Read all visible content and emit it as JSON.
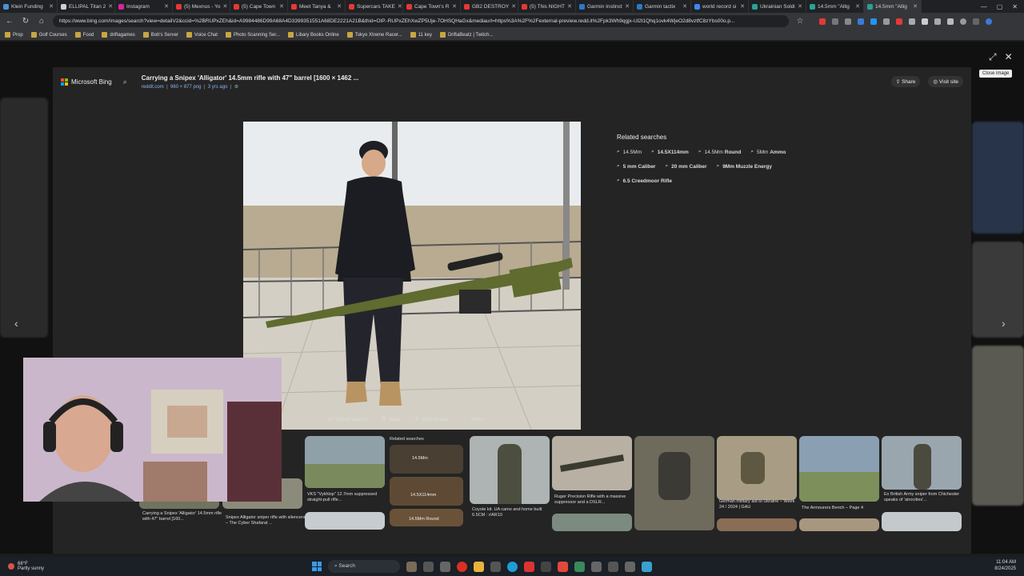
{
  "tabs": [
    {
      "label": "Klein Funding",
      "color": "#4a90d9"
    },
    {
      "label": "ELLIPAL Titan 2",
      "color": "#cfcfcf"
    },
    {
      "label": "Instagram",
      "color": "#d6249f"
    },
    {
      "label": "(5) Mexnus - Yo",
      "color": "#e53935"
    },
    {
      "label": "(5) Cape Town",
      "color": "#e53935"
    },
    {
      "label": "Meet Tanya &",
      "color": "#e53935"
    },
    {
      "label": "Supercars TAKE",
      "color": "#e53935"
    },
    {
      "label": "Cape Town's R",
      "color": "#e53935"
    },
    {
      "label": "GB2 DESTROY",
      "color": "#e53935"
    },
    {
      "label": "(5) This NIGHT",
      "color": "#e53935"
    },
    {
      "label": "Garmin Instinct",
      "color": "#2a7ac9"
    },
    {
      "label": "Garmin tactix",
      "color": "#2a7ac9"
    },
    {
      "label": "world record si",
      "color": "#4285f4"
    },
    {
      "label": "Ukrainian Soldi",
      "color": "#2aa198"
    },
    {
      "label": "14.5mm \"Allig",
      "color": "#2aa198"
    },
    {
      "label": "14.5mm \"Allig",
      "color": "#2aa198"
    }
  ],
  "address": {
    "url": "https://www.bing.com/images/search?view=detailV2&ccid=%2BRUPxZEh&id=A9984486D99A68A4D3399351551A68DE2221A21B&thid=OIP.-RUPxZEhXwZP5Uje-7OHSQHaGx&mediaurl=https%3A%2F%2Fexternal-preview.redd.it%2Fpk3Wh9qgjx-Ul2t1Qhq1ovk4WjeO2d8vztfC8zYbs00o.p..."
  },
  "bookmarks": [
    "Prop",
    "Golf Courses",
    "Food",
    "driftagames",
    "Bob's Server",
    "Voice Chat",
    "Photo Scanning Ser...",
    "Libary Books Online",
    "Tokyo Xtreme Racer...",
    "11 key",
    "DriftaBeatz | Twitch..."
  ],
  "modal": {
    "brand": "Microsoft Bing",
    "title": "Carrying a Snipex 'Alligator' 14.5mm rifle with 47\" barrel [1600 × 1462 ...",
    "source": "reddit.com",
    "size": "960 × 877 png",
    "age": "3 yrs ago",
    "share": "Share",
    "visit": "Visit site",
    "close_tip": "Close image"
  },
  "related": {
    "heading": "Related searches",
    "chips": [
      {
        "pre": "14.5Mm",
        "bold": ""
      },
      {
        "pre": "",
        "bold": "14.5X114mm"
      },
      {
        "pre": "14.5Mm ",
        "bold": "Round"
      },
      {
        "pre": "5Mm ",
        "bold": "Ammo"
      },
      {
        "pre": "",
        "bold": "5 mm Caliber"
      },
      {
        "pre": "",
        "bold": "20 mm Caliber"
      },
      {
        "pre": "",
        "bold": "9Mm Muzzle Energy"
      },
      {
        "pre": "",
        "bold": "6.5 Creedmoor Rifle"
      }
    ]
  },
  "actions": {
    "visual": "Visual Search",
    "save": "Save",
    "view": "View image",
    "more": "More"
  },
  "strip": {
    "captions": [
      "Carrying a Snipex 'Alligator' 14.5mm rifle with 47\" barrel [160...",
      "Snipex Alligator sniper rifle with silencers – The Cyber Shafarat ...",
      "VKS \"Vykhlop\" 12.7mm suppressed straight-pull rifle...",
      "Coyote kit. UA camo and home built 6.5CM : r/AR10",
      "Ruger Precision Rifle with a massive suppressor and a DSLR...",
      "German military aid to Ukraine – Week 24 / 2024 | GAU",
      "The Armourers Bench – Page 4",
      "Ex British Army sniper from Chichester speaks of 'atrocities'..."
    ],
    "related_label": "Related searches",
    "rel1": "14.5Mm",
    "rel2": "14.5X114mm",
    "rel3": "14.5Mm Round"
  },
  "taskbar": {
    "temp": "68°F",
    "weather": "Partly sunny",
    "search": "Search",
    "time": "11:04 AM",
    "date": "8/24/2025"
  }
}
